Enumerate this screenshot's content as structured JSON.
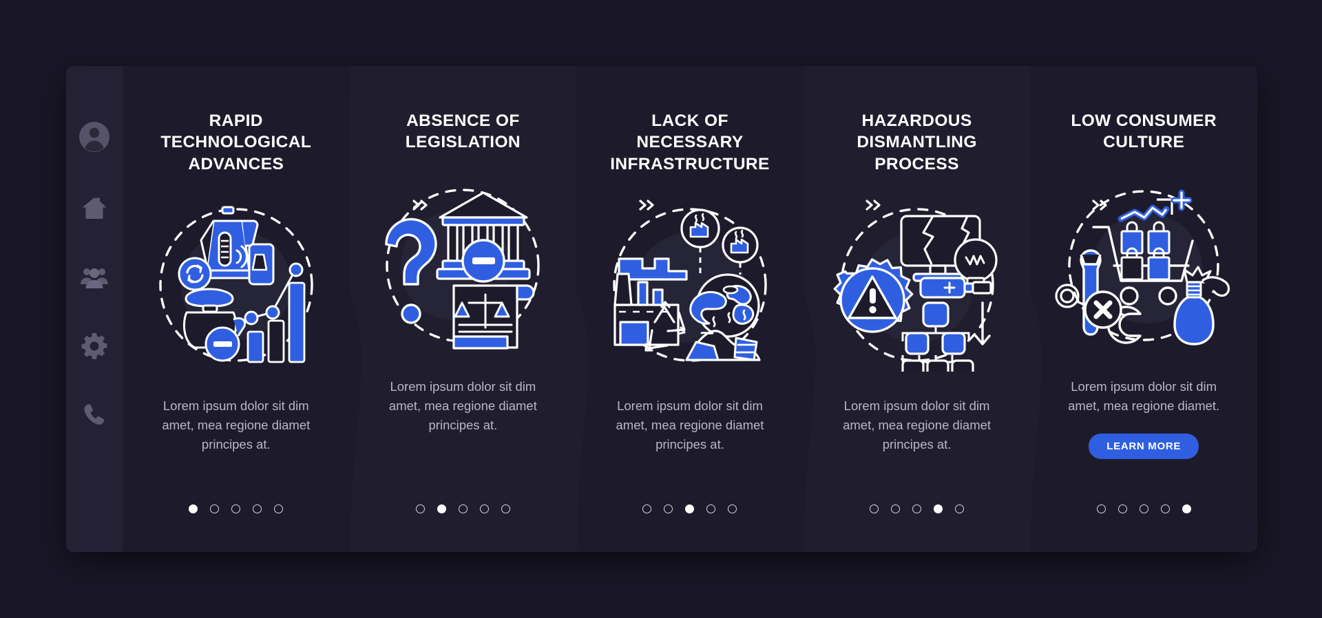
{
  "theme": {
    "page_bg": "#191727",
    "panel_bg": "#1e1c2c",
    "sidebar_bg": "#232133",
    "accent": "#2f5fe0",
    "title_color": "#ffffff",
    "body_color": "#b9b7c6",
    "icon_color": "#5e5b70"
  },
  "sidebar": {
    "items": [
      {
        "icon": "user-avatar-icon",
        "label": "Profile"
      },
      {
        "icon": "home-icon",
        "label": "Home"
      },
      {
        "icon": "people-group-icon",
        "label": "Community"
      },
      {
        "icon": "gear-icon",
        "label": "Settings"
      },
      {
        "icon": "phone-icon",
        "label": "Contact"
      }
    ]
  },
  "separator": {
    "glyph": "»",
    "name": "double-chevron-right-icon"
  },
  "cards": [
    {
      "title": "RAPID TECHNOLOGICAL ADVANCES",
      "desc": "Lorem ipsum dolor sit dim amet, mea regione diamet principes at.",
      "illustration": "smart-kettle-technology-illustration",
      "dots": {
        "count": 5,
        "active": 1
      },
      "cta": null
    },
    {
      "title": "ABSENCE OF LEGISLATION",
      "desc": "Lorem ipsum dolor sit dim amet, mea regione diamet principes at.",
      "illustration": "courthouse-legislation-illustration",
      "dots": {
        "count": 5,
        "active": 2
      },
      "cta": null
    },
    {
      "title": "LACK OF NECESSARY INFRASTRUCTURE",
      "desc": "Lorem ipsum dolor sit dim amet, mea regione diamet principes at.",
      "illustration": "factory-pollution-globe-illustration",
      "dots": {
        "count": 5,
        "active": 3
      },
      "cta": null
    },
    {
      "title": "HAZARDOUS DISMANTLING PROCESS",
      "desc": "Lorem ipsum dolor sit dim amet, mea regione diamet principes at.",
      "illustration": "hazard-gear-ewaste-illustration",
      "dots": {
        "count": 5,
        "active": 4
      },
      "cta": null
    },
    {
      "title": "LOW CONSUMER CULTURE",
      "desc": "Lorem ipsum dolor sit dim amet, mea regione diamet.",
      "illustration": "shopping-cart-waste-illustration",
      "dots": {
        "count": 5,
        "active": 5
      },
      "cta": "LEARN MORE"
    }
  ]
}
